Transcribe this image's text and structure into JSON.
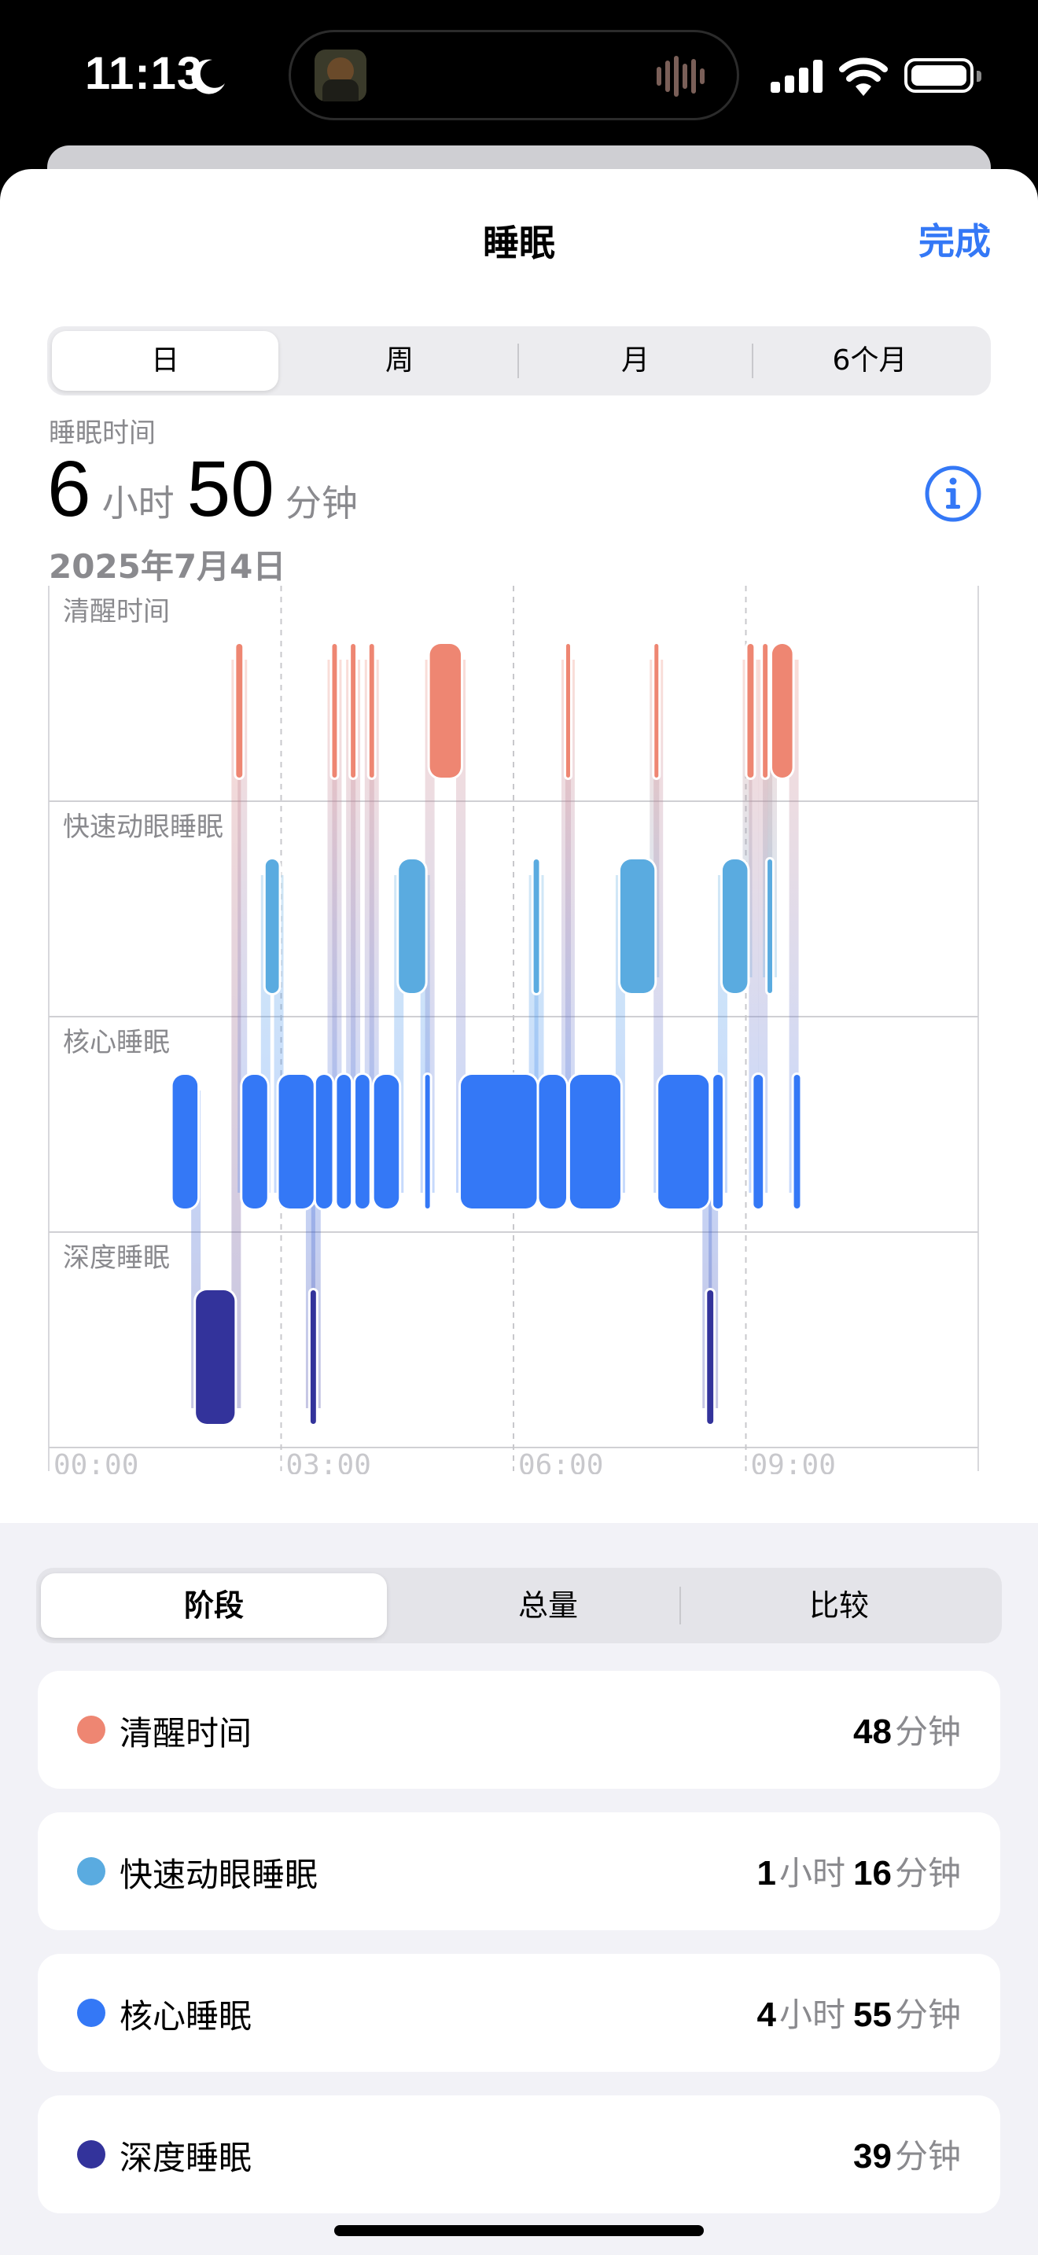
{
  "status": {
    "time": "11:13"
  },
  "nav": {
    "title": "睡眠",
    "done": "完成"
  },
  "range_tabs": [
    "日",
    "周",
    "月",
    "6个月"
  ],
  "range_selected": "日",
  "metric": {
    "label": "睡眠时间",
    "hours": "6",
    "hours_unit": "小时",
    "minutes": "50",
    "minutes_unit": "分钟",
    "date": "2025年7月4日"
  },
  "chart_data": {
    "type": "hypnogram",
    "stages": [
      "清醒时间",
      "快速动眼睡眠",
      "核心睡眠",
      "深度睡眠"
    ],
    "x_ticks": [
      "00:00",
      "03:00",
      "06:00",
      "09:00"
    ],
    "x_range_hours": [
      0,
      12
    ],
    "colors": {
      "清醒时间": "#ee8672",
      "快速动眼睡眠": "#5aabe0",
      "核心睡眠": "#3478f6",
      "深度睡眠": "#33339b"
    },
    "segments": [
      {
        "stage": "核心睡眠",
        "start": 1.6,
        "end": 1.92
      },
      {
        "stage": "深度睡眠",
        "start": 1.9,
        "end": 2.4
      },
      {
        "stage": "清醒时间",
        "start": 2.42,
        "end": 2.5
      },
      {
        "stage": "核心睡眠",
        "start": 2.5,
        "end": 2.82
      },
      {
        "stage": "快速动眼睡眠",
        "start": 2.8,
        "end": 2.97
      },
      {
        "stage": "核心睡眠",
        "start": 2.97,
        "end": 3.42
      },
      {
        "stage": "深度睡眠",
        "start": 3.38,
        "end": 3.45
      },
      {
        "stage": "核心睡眠",
        "start": 3.45,
        "end": 3.66
      },
      {
        "stage": "清醒时间",
        "start": 3.66,
        "end": 3.72
      },
      {
        "stage": "核心睡眠",
        "start": 3.72,
        "end": 3.9
      },
      {
        "stage": "清醒时间",
        "start": 3.9,
        "end": 3.96
      },
      {
        "stage": "核心睡眠",
        "start": 3.96,
        "end": 4.14
      },
      {
        "stage": "清醒时间",
        "start": 4.14,
        "end": 4.2
      },
      {
        "stage": "核心睡眠",
        "start": 4.2,
        "end": 4.52
      },
      {
        "stage": "快速动眼睡眠",
        "start": 4.52,
        "end": 4.86
      },
      {
        "stage": "核心睡眠",
        "start": 4.86,
        "end": 4.92
      },
      {
        "stage": "清醒时间",
        "start": 4.92,
        "end": 5.32
      },
      {
        "stage": "核心睡眠",
        "start": 5.32,
        "end": 6.3
      },
      {
        "stage": "快速动眼睡眠",
        "start": 6.26,
        "end": 6.33
      },
      {
        "stage": "核心睡眠",
        "start": 6.33,
        "end": 6.68
      },
      {
        "stage": "清醒时间",
        "start": 6.68,
        "end": 6.73
      },
      {
        "stage": "核心睡眠",
        "start": 6.73,
        "end": 7.38
      },
      {
        "stage": "快速动眼睡眠",
        "start": 7.38,
        "end": 7.82
      },
      {
        "stage": "清醒时间",
        "start": 7.82,
        "end": 7.87
      },
      {
        "stage": "核心睡眠",
        "start": 7.87,
        "end": 8.52
      },
      {
        "stage": "深度睡眠",
        "start": 8.5,
        "end": 8.58
      },
      {
        "stage": "核心睡眠",
        "start": 8.58,
        "end": 8.7
      },
      {
        "stage": "快速动眼睡眠",
        "start": 8.7,
        "end": 9.02
      },
      {
        "stage": "清醒时间",
        "start": 9.02,
        "end": 9.1
      },
      {
        "stage": "核心睡眠",
        "start": 9.1,
        "end": 9.22
      },
      {
        "stage": "清醒时间",
        "start": 9.22,
        "end": 9.28
      },
      {
        "stage": "快速动眼睡眠",
        "start": 9.28,
        "end": 9.34
      },
      {
        "stage": "清醒时间",
        "start": 9.34,
        "end": 9.6
      },
      {
        "stage": "核心睡眠",
        "start": 9.62,
        "end": 9.7
      }
    ]
  },
  "view_tabs": [
    "阶段",
    "总量",
    "比较"
  ],
  "view_selected": "阶段",
  "summary": [
    {
      "stage": "清醒时间",
      "color": "#ee8672",
      "parts": [
        {
          "n": "48",
          "u": "分钟"
        }
      ]
    },
    {
      "stage": "快速动眼睡眠",
      "color": "#5aabe0",
      "parts": [
        {
          "n": "1",
          "u": "小时"
        },
        {
          "n": "16",
          "u": "分钟"
        }
      ]
    },
    {
      "stage": "核心睡眠",
      "color": "#3478f6",
      "parts": [
        {
          "n": "4",
          "u": "小时"
        },
        {
          "n": "55",
          "u": "分钟"
        }
      ]
    },
    {
      "stage": "深度睡眠",
      "color": "#33339b",
      "parts": [
        {
          "n": "39",
          "u": "分钟"
        }
      ]
    }
  ]
}
